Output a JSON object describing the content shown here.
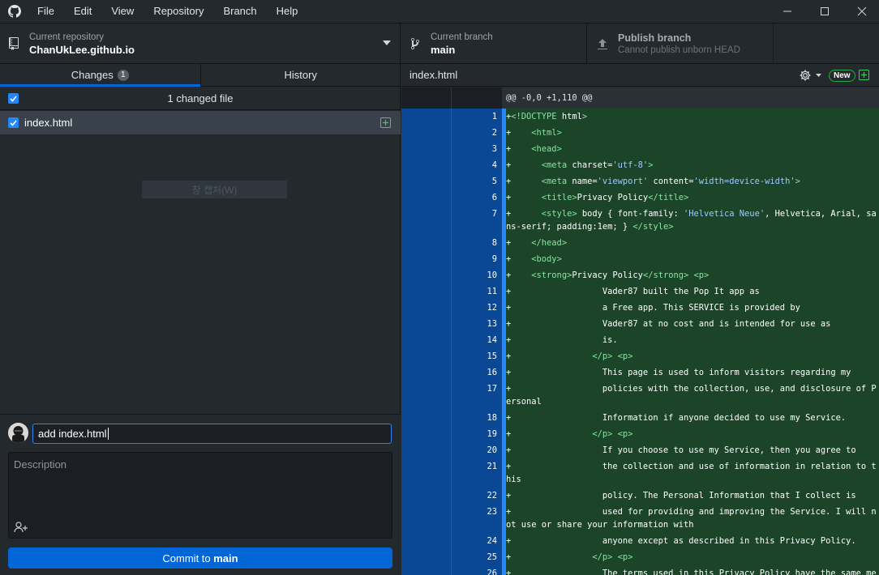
{
  "menubar": {
    "items": [
      "File",
      "Edit",
      "View",
      "Repository",
      "Branch",
      "Help"
    ]
  },
  "toolbar": {
    "repo_label": "Current repository",
    "repo_name": "ChanUkLee.github.io",
    "branch_label": "Current branch",
    "branch_name": "main",
    "publish_title": "Publish branch",
    "publish_sub": "Cannot publish unborn HEAD"
  },
  "tabs": {
    "changes": "Changes",
    "changes_count": "1",
    "history": "History"
  },
  "changes": {
    "header": "1 changed file",
    "file": "index.html",
    "ghost_tooltip": "창 캡처(W)"
  },
  "commit": {
    "summary": "add index.html",
    "description_placeholder": "Description",
    "button_prefix": "Commit to ",
    "button_branch": "main"
  },
  "diff": {
    "filename": "index.html",
    "new_badge": "New",
    "hunk": "@@ -0,0 +1,110 @@",
    "lines": [
      {
        "n": "1",
        "t": "+<!DOCTYPE html>"
      },
      {
        "n": "2",
        "t": "+    <html>"
      },
      {
        "n": "3",
        "t": "+    <head>"
      },
      {
        "n": "4",
        "t": "+      <meta charset='utf-8'>"
      },
      {
        "n": "5",
        "t": "+      <meta name='viewport' content='width=device-width'>"
      },
      {
        "n": "6",
        "t": "+      <title>Privacy Policy</title>"
      },
      {
        "n": "7",
        "t": "+      <style> body { font-family: 'Helvetica Neue', Helvetica, Arial, sans-serif; padding:1em; } </style>"
      },
      {
        "n": "8",
        "t": "+    </head>"
      },
      {
        "n": "9",
        "t": "+    <body>"
      },
      {
        "n": "10",
        "t": "+    <strong>Privacy Policy</strong> <p>"
      },
      {
        "n": "11",
        "t": "+                  Vader87 built the Pop It app as"
      },
      {
        "n": "12",
        "t": "+                  a Free app. This SERVICE is provided by"
      },
      {
        "n": "13",
        "t": "+                  Vader87 at no cost and is intended for use as"
      },
      {
        "n": "14",
        "t": "+                  is."
      },
      {
        "n": "15",
        "t": "+                </p> <p>"
      },
      {
        "n": "16",
        "t": "+                  This page is used to inform visitors regarding my"
      },
      {
        "n": "17",
        "t": "+                  policies with the collection, use, and disclosure of Personal"
      },
      {
        "n": "18",
        "t": "+                  Information if anyone decided to use my Service."
      },
      {
        "n": "19",
        "t": "+                </p> <p>"
      },
      {
        "n": "20",
        "t": "+                  If you choose to use my Service, then you agree to"
      },
      {
        "n": "21",
        "t": "+                  the collection and use of information in relation to this"
      },
      {
        "n": "22",
        "t": "+                  policy. The Personal Information that I collect is"
      },
      {
        "n": "23",
        "t": "+                  used for providing and improving the Service. I will not use or share your information with"
      },
      {
        "n": "24",
        "t": "+                  anyone except as described in this Privacy Policy."
      },
      {
        "n": "25",
        "t": "+                </p> <p>"
      },
      {
        "n": "26",
        "t": "+                  The terms used in this Privacy Policy have the same meanings"
      }
    ]
  }
}
